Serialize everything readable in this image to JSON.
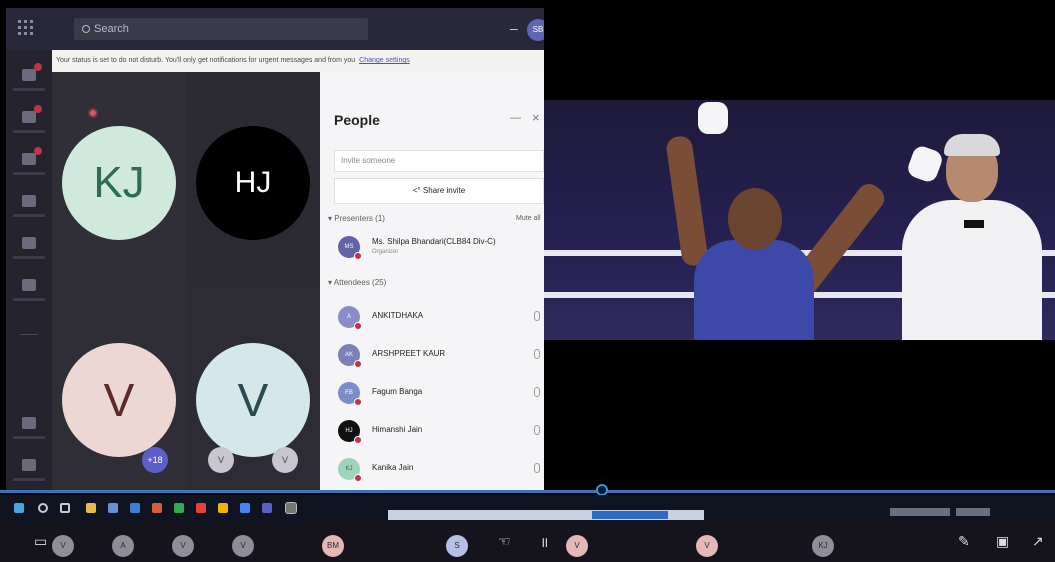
{
  "window": {
    "search_placeholder": "Search",
    "minimize_glyph": "–",
    "me_initials": "SB"
  },
  "banner": {
    "text": "Your status is set to do not disturb. You'll only get notifications for urgent messages and from you",
    "link": "Change settings"
  },
  "rail": {
    "items": [
      "Activity",
      "Chat",
      "Teams",
      "Assignments",
      "Calendar",
      "Calls",
      "Apps",
      "Help"
    ]
  },
  "stage": {
    "tiles": [
      {
        "initials": "KJ",
        "bg": "#cfe9dc",
        "fg": "#2f6b55"
      },
      {
        "initials": "HJ",
        "bg": "#000000",
        "fg": "#ffffff"
      },
      {
        "initials": "V",
        "bg": "#ecd7d5",
        "fg": "#5d2a2a"
      },
      {
        "initials": "V",
        "bg": "#d4e8eb",
        "fg": "#2c4a52"
      }
    ],
    "overflow": [
      "+18",
      "V",
      "V"
    ]
  },
  "people": {
    "title": "People",
    "invite_placeholder": "Invite someone",
    "share_invite": "Share invite",
    "presenters_header": "Presenters (1)",
    "presenters_action": "Mute all",
    "presenters": [
      {
        "initials": "MS",
        "name": "Ms. Shilpa Bhandari(CLB84 Div-C)",
        "role": "Organizer",
        "color": "#6264a7"
      }
    ],
    "attendees_header": "Attendees (25)",
    "attendees": [
      {
        "initials": "A",
        "name": "ANKITDHAKA",
        "color": "#8b8cc7"
      },
      {
        "initials": "AK",
        "name": "ARSHPREET KAUR",
        "color": "#7e80b8"
      },
      {
        "initials": "FB",
        "name": "Fagum Banga",
        "color": "#7a8fc7"
      },
      {
        "initials": "HJ",
        "name": "Himanshi Jain",
        "color": "#111111"
      },
      {
        "initials": "KJ",
        "name": "Kanika Jain",
        "color": "#9fd4bc"
      }
    ]
  },
  "strip": {
    "participants": [
      "V",
      "A",
      "V",
      "V",
      "BM",
      "S",
      "V",
      "V",
      "KJ"
    ],
    "colors": {
      "gray": "#8f8d98",
      "pink": "#e3b8b6",
      "blue": "#b6c0e6"
    }
  },
  "colors": {
    "accent": "#5b5fc7",
    "alert": "#c4314b",
    "scrub": "#3a8fd8"
  }
}
